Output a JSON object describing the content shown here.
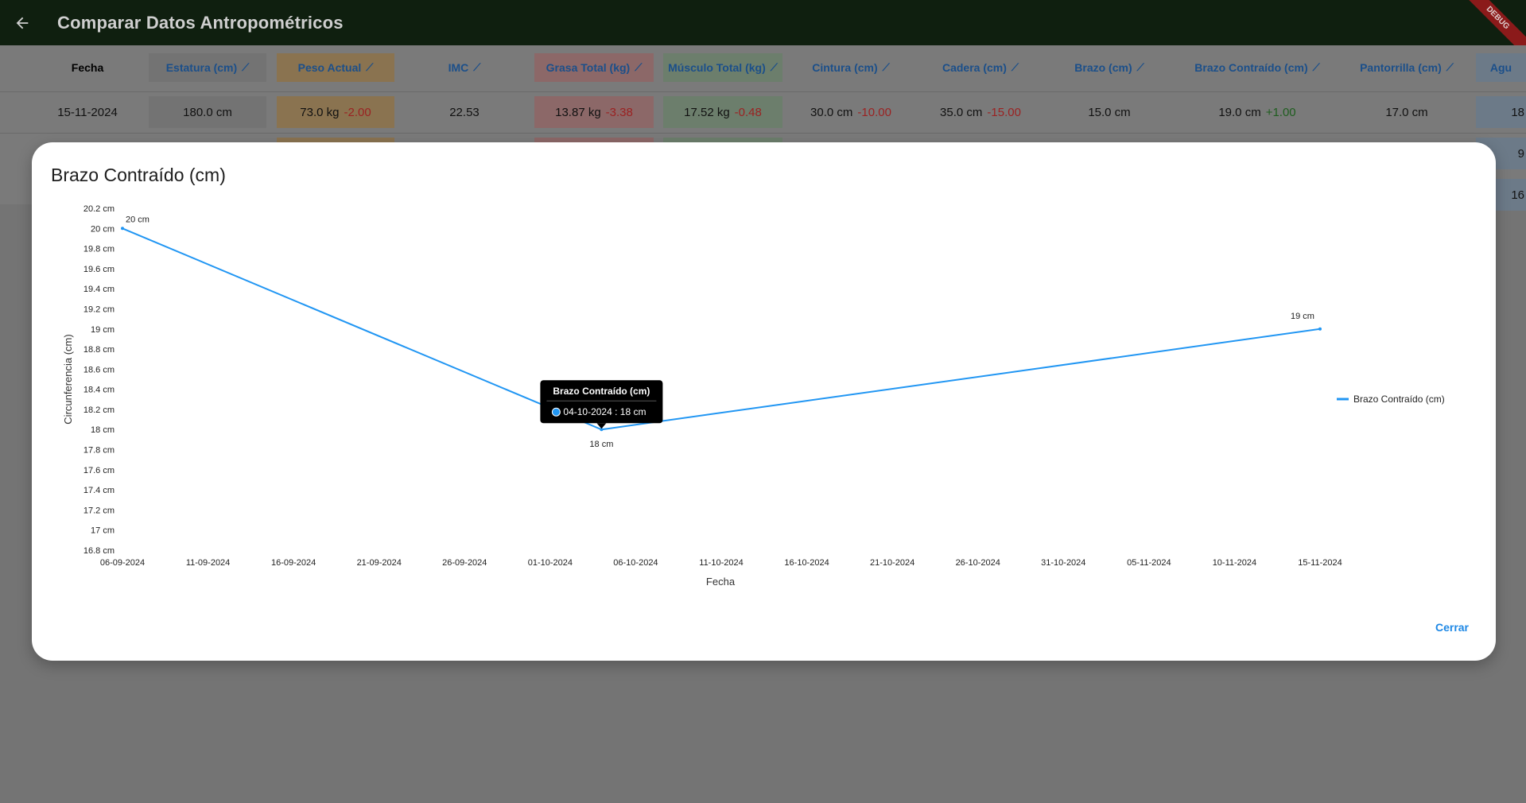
{
  "appbar": {
    "title": "Comparar Datos Antropométricos",
    "back_icon": "arrow-back-icon",
    "debug_label": "DEBUG"
  },
  "table": {
    "columns": [
      "Fecha",
      "Estatura (cm)",
      "Peso Actual",
      "IMC",
      "Grasa Total (kg)",
      "Músculo Total (kg)",
      "Cintura (cm)",
      "Cadera (cm)",
      "Brazo (cm)",
      "Brazo Contraído (cm)",
      "Pantorrilla (cm)",
      "Agu"
    ],
    "row1": {
      "fecha": "15-11-2024",
      "estatura": "180.0 cm",
      "peso": "73.0 kg",
      "peso_delta": "-2.00",
      "imc": "22.53",
      "grasa": "13.87 kg",
      "grasa_delta": "-3.38",
      "musculo": "17.52 kg",
      "musculo_delta": "-0.48",
      "cintura": "30.0 cm",
      "cintura_delta": "-10.00",
      "cadera": "35.0 cm",
      "cadera_delta": "-15.00",
      "brazo": "15.0 cm",
      "brazo_contraido": "19.0 cm",
      "brazo_contraido_delta": "+1.00",
      "pantorrilla": "17.0 cm",
      "agu": "18"
    },
    "row2_partial": "9",
    "row3_partial": "16"
  },
  "dialog": {
    "title": "Brazo Contraído (cm)",
    "close_label": "Cerrar",
    "tooltip": {
      "title": "Brazo Contraído (cm)",
      "text": "04-10-2024 : 18 cm"
    }
  },
  "chart_data": {
    "type": "line",
    "title": "Brazo Contraído (cm)",
    "xlabel": "Fecha",
    "ylabel": "Circunferencia (cm)",
    "x_ticks": [
      "06-09-2024",
      "11-09-2024",
      "16-09-2024",
      "21-09-2024",
      "26-09-2024",
      "01-10-2024",
      "06-10-2024",
      "11-10-2024",
      "16-10-2024",
      "21-10-2024",
      "26-10-2024",
      "31-10-2024",
      "05-11-2024",
      "10-11-2024",
      "15-11-2024"
    ],
    "y_ticks": [
      "20.2 cm",
      "20 cm",
      "19.8 cm",
      "19.6 cm",
      "19.4 cm",
      "19.2 cm",
      "19 cm",
      "18.8 cm",
      "18.6 cm",
      "18.4 cm",
      "18.2 cm",
      "18 cm",
      "17.8 cm",
      "17.6 cm",
      "17.4 cm",
      "17.2 cm",
      "17 cm",
      "16.8 cm"
    ],
    "ylim": [
      16.8,
      20.2
    ],
    "xlim": [
      "06-09-2024",
      "15-11-2024"
    ],
    "series": [
      {
        "name": "Brazo Contraído (cm)",
        "color": "#2196f3",
        "points": [
          {
            "x": "06-09-2024",
            "y": 20,
            "label": "20 cm"
          },
          {
            "x": "04-10-2024",
            "y": 18,
            "label": "18 cm"
          },
          {
            "x": "15-11-2024",
            "y": 19,
            "label": "19 cm"
          }
        ]
      }
    ],
    "legend": "right",
    "grid": false
  }
}
